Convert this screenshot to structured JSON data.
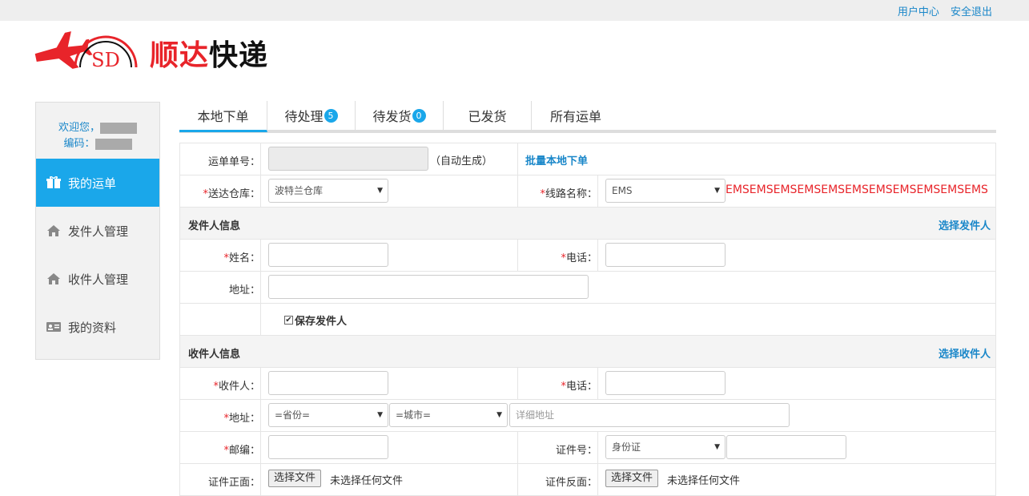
{
  "topbar": {
    "user_center": "用户中心",
    "logout": "安全退出"
  },
  "logo": {
    "emblem_text": "SD",
    "brand_part1": "顺达",
    "brand_part2": "快递"
  },
  "sidebar": {
    "welcome_label": "欢迎您，",
    "code_label": "编码：",
    "items": [
      {
        "label": "我的运单",
        "icon": "gift-icon",
        "active": true
      },
      {
        "label": "发件人管理",
        "icon": "home-icon",
        "active": false
      },
      {
        "label": "收件人管理",
        "icon": "home-icon",
        "active": false
      },
      {
        "label": "我的资料",
        "icon": "id-card-icon",
        "active": false
      }
    ]
  },
  "tabs": [
    {
      "label": "本地下单",
      "badge": ""
    },
    {
      "label": "待处理",
      "badge": "5"
    },
    {
      "label": "待发货",
      "badge": "0"
    },
    {
      "label": "已发货",
      "badge": ""
    },
    {
      "label": "所有运单",
      "badge": ""
    }
  ],
  "form": {
    "waybill_label": "运单单号：",
    "auto_note": "（自动生成）",
    "batch_link": "批量本地下单",
    "warehouse_label": "送达仓库：",
    "warehouse_value": "波特兰仓库",
    "route_label": "线路名称：",
    "route_value": "EMS",
    "route_note": "EMSEMSEMSEMSEMSEMSEMSEMSEMSEMSEMS",
    "sender_section": "发件人信息",
    "select_sender": "选择发件人",
    "name_label": "姓名：",
    "phone_label": "电话：",
    "address_label": "地址：",
    "save_sender": "保存发件人",
    "receiver_section": "收件人信息",
    "select_receiver": "选择收件人",
    "receiver_label": "收件人：",
    "receiver_phone_label": "电话：",
    "receiver_address_label": "地址：",
    "province_placeholder": "=省份=",
    "city_placeholder": "=城市=",
    "detail_address_placeholder": "详细地址",
    "postcode_label": "邮编：",
    "id_number_label": "证件号：",
    "id_type_value": "身份证",
    "id_front_label": "证件正面：",
    "id_back_label": "证件反面：",
    "choose_file": "选择文件",
    "no_file": "未选择任何文件"
  },
  "colors": {
    "accent": "#1aa7ea",
    "link": "#1a87c9",
    "brand_red": "#e8242a"
  }
}
